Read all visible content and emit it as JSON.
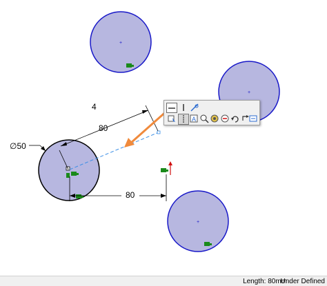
{
  "sketch": {
    "colors": {
      "circle_fill": "#b7b7e0",
      "circle_stroke": "#1818c8",
      "selected_stroke": "#000000",
      "dimension": "#000000",
      "construction_line": "#3a8ee6",
      "arrow": "#f08a3c",
      "origin_red": "#d01010",
      "relation_green": "#1a8a1a"
    },
    "dimensions": {
      "angled_label": "80",
      "horizontal_label": "80",
      "diameter_label": "∅50",
      "number_4": "4"
    }
  },
  "context_toolbar": {
    "items": [
      {
        "name": "horizontal-icon"
      },
      {
        "name": "vertical-icon"
      },
      {
        "name": "make-fix-icon"
      },
      {
        "name": "select-other-icon"
      },
      {
        "name": "construction-geometry-icon"
      },
      {
        "name": "text-icon"
      },
      {
        "name": "zoom-to-selection-icon"
      },
      {
        "name": "view-icon"
      },
      {
        "name": "relations-icon"
      },
      {
        "name": "undo-icon"
      },
      {
        "name": "more-icon"
      },
      {
        "name": "smart-dimension-icon"
      }
    ]
  },
  "statusbar": {
    "length": "Length: 80mm",
    "state": "Under Defined"
  }
}
